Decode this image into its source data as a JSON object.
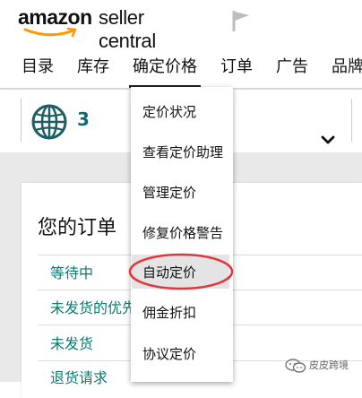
{
  "header": {
    "logo_amazon": "amazon",
    "logo_product": "seller central",
    "brand_color": "#ff9900",
    "nav": [
      {
        "label": "目录"
      },
      {
        "label": "库存"
      },
      {
        "label": "确定价格",
        "active": true
      },
      {
        "label": "订单"
      },
      {
        "label": "广告"
      },
      {
        "label": "品牌"
      }
    ]
  },
  "marketplace": {
    "icon": "globe-icon",
    "count": "3",
    "accent_color": "#0a6d6d"
  },
  "dropdown": {
    "items": [
      {
        "label": "定价状况"
      },
      {
        "label": "查看定价助理"
      },
      {
        "label": "管理定价"
      },
      {
        "label": "修复价格警告"
      },
      {
        "label": "自动定价",
        "highlighted": true
      },
      {
        "label": "佣金折扣"
      },
      {
        "label": "协议定价"
      }
    ],
    "annotation_color": "#e0383c"
  },
  "orders_card": {
    "title": "您的订单",
    "links": [
      {
        "label": "等待中"
      },
      {
        "label": "未发货的优先"
      },
      {
        "label": "未发货"
      },
      {
        "label": "退货请求"
      }
    ],
    "link_color": "#0a7a6e"
  },
  "watermark": {
    "text": "皮皮跨境",
    "icon": "wechat-icon"
  }
}
